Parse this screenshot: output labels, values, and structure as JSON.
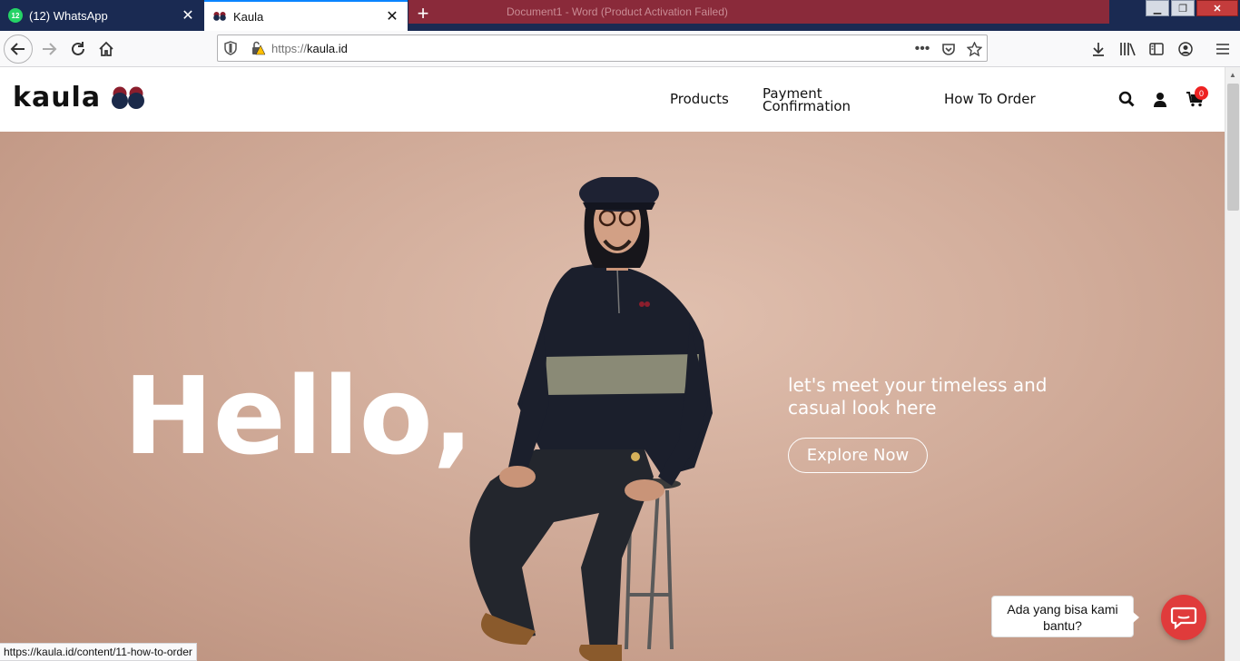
{
  "browser": {
    "tabs": [
      {
        "title": "(12) WhatsApp",
        "badge": "12",
        "active": false
      },
      {
        "title": "Kaula",
        "active": true
      }
    ],
    "background_window_title": "Document1 - Word (Product Activation Failed)",
    "url_protocol": "https://",
    "url_host": "kaula.id",
    "status_url": "https://kaula.id/content/11-how-to-order"
  },
  "site": {
    "logo_text": "kaula",
    "nav": {
      "products": "Products",
      "payment_line1": "Payment",
      "payment_line2": "Confirmation",
      "how_to_order": "How To Order"
    },
    "cart_count": "0"
  },
  "hero": {
    "headline": "Hello,",
    "tagline": "let's meet your timeless and casual look here",
    "cta": "Explore Now"
  },
  "chat": {
    "prompt": "Ada yang bisa kami bantu?"
  },
  "colors": {
    "brand_navy": "#1b2a4a",
    "brand_red": "#8b1e2d",
    "hero_bg": "#d2ad9b",
    "chat_red": "#e03b3b",
    "cart_badge": "#ee2222"
  }
}
